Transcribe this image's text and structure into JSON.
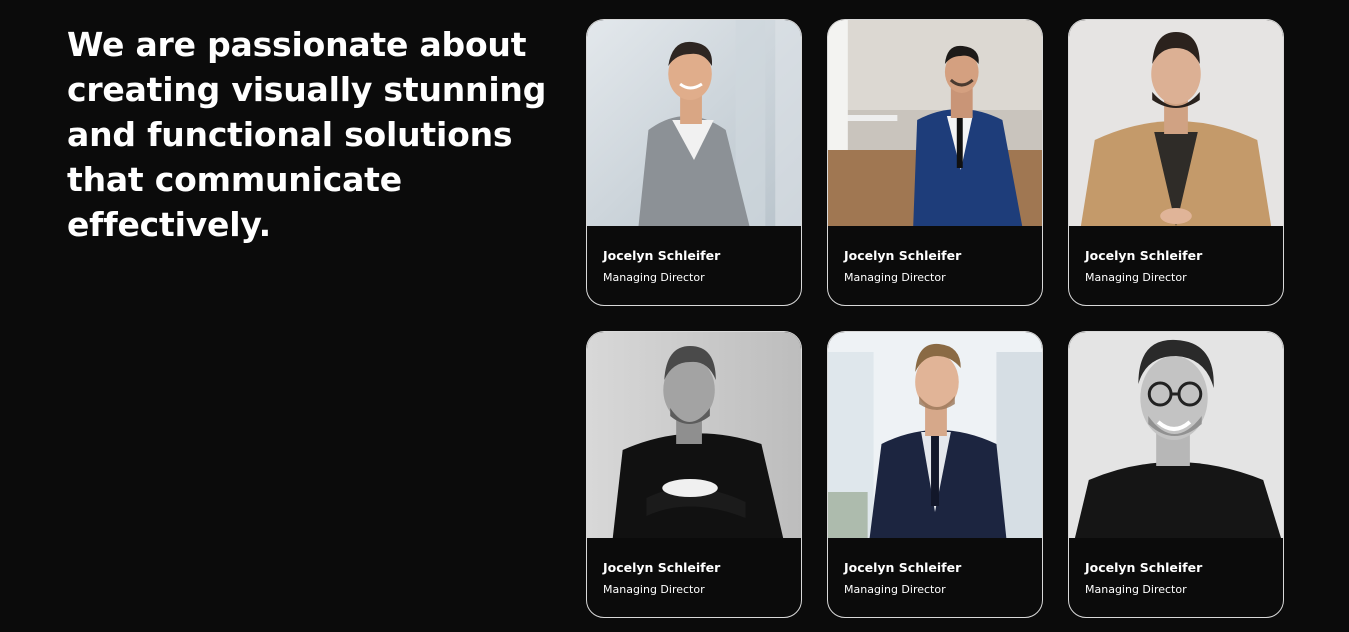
{
  "headline": "We are passionate about creating visually stunning and functional solutions that communicate effectively.",
  "team": [
    {
      "name": "Jocelyn Schleifer",
      "role": "Managing Director"
    },
    {
      "name": "Jocelyn Schleifer",
      "role": "Managing Director"
    },
    {
      "name": "Jocelyn Schleifer",
      "role": "Managing Director"
    },
    {
      "name": "Jocelyn Schleifer",
      "role": "Managing Director"
    },
    {
      "name": "Jocelyn Schleifer",
      "role": "Managing Director"
    },
    {
      "name": "Jocelyn Schleifer",
      "role": "Managing Director"
    }
  ],
  "colors": {
    "background": "#0b0b0b",
    "card_border": "#d9d9d9",
    "text": "#ffffff"
  }
}
